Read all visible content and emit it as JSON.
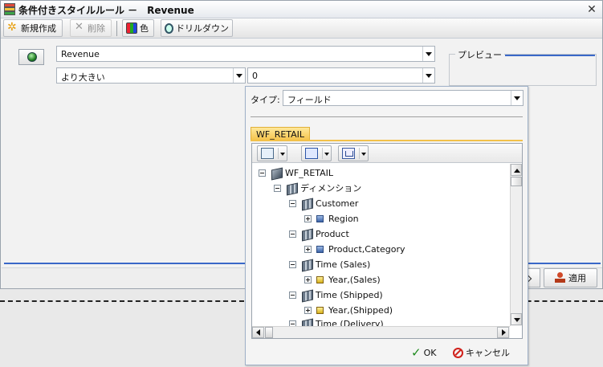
{
  "window": {
    "title": "条件付きスタイルルール －　Revenue",
    "close_glyph": "✕"
  },
  "toolbar": {
    "new_label": "新規作成",
    "delete_label": "削除",
    "color_label": "色",
    "drilldown_label": "ドリルダウン"
  },
  "form": {
    "field_value": "Revenue",
    "operator_value": "より大きい",
    "compare_value": "0",
    "preview_label": "プレビュー"
  },
  "popup": {
    "type_label": "タイプ:",
    "type_value": "フィールド",
    "tab_label": "WF_RETAIL",
    "tree": [
      {
        "label": "WF_RETAIL",
        "icon": "cube-icon",
        "expander": "minus"
      },
      {
        "label": "ディメンション",
        "icon": "dimension-icon",
        "expander": "minus"
      },
      {
        "label": "Customer",
        "icon": "dimension-icon",
        "expander": "minus"
      },
      {
        "label": "Region",
        "icon": "field-icon",
        "expander": "plus"
      },
      {
        "label": "Product",
        "icon": "dimension-icon",
        "expander": "minus"
      },
      {
        "label": "Product,Category",
        "icon": "field-icon",
        "expander": "plus"
      },
      {
        "label": "Time (Sales)",
        "icon": "dimension-icon",
        "expander": "minus"
      },
      {
        "label": "Year,(Sales)",
        "icon": "year-field-icon",
        "expander": "plus"
      },
      {
        "label": "Time (Shipped)",
        "icon": "dimension-icon",
        "expander": "minus"
      },
      {
        "label": "Year,(Shipped)",
        "icon": "year-field-icon",
        "expander": "plus"
      },
      {
        "label": "Time (Delivery)",
        "icon": "dimension-icon",
        "expander": "minus"
      }
    ],
    "ok_label": "OK",
    "cancel_label": "キャンセル"
  },
  "footer": {
    "apply_label": "適用"
  },
  "colors": {
    "accent_blue": "#3a68c8",
    "tab_yellow": "#f4c24a",
    "ok_green": "#1e8a1e",
    "cancel_red": "#d0201a"
  }
}
